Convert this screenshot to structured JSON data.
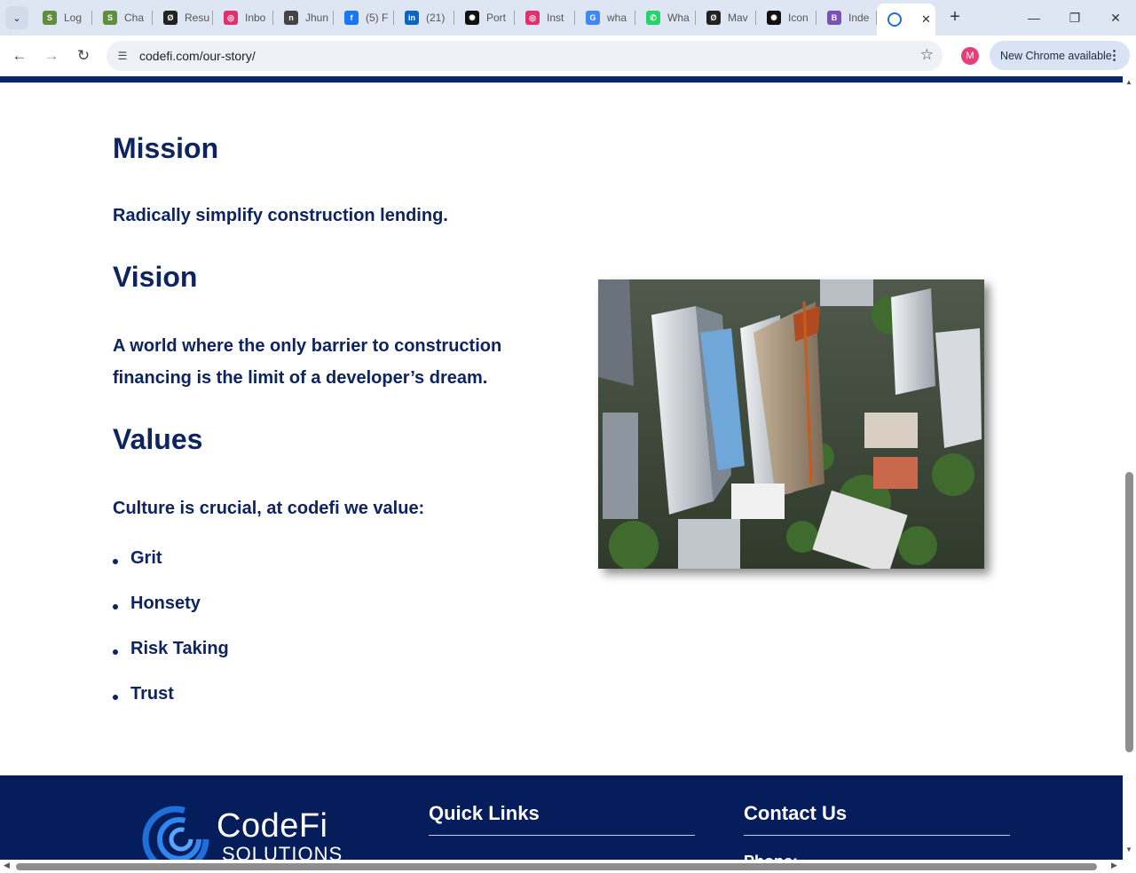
{
  "browser": {
    "tabs": [
      {
        "title": "Log",
        "icon": "shopify-icon",
        "color": "#5e8e3e",
        "glyph": "S"
      },
      {
        "title": "Cha",
        "icon": "shopify-icon",
        "color": "#5e8e3e",
        "glyph": "S"
      },
      {
        "title": "Resu",
        "icon": "slash-circle-icon",
        "color": "#222222",
        "glyph": "Ø"
      },
      {
        "title": "Inbo",
        "icon": "instagram-icon",
        "color": "#e1306c",
        "glyph": "◎"
      },
      {
        "title": "Jhun",
        "icon": "news-icon",
        "color": "#444444",
        "glyph": "n"
      },
      {
        "title": "(5) F",
        "icon": "facebook-icon",
        "color": "#1877f2",
        "glyph": "f"
      },
      {
        "title": "(21)",
        "icon": "linkedin-icon",
        "color": "#0a66c2",
        "glyph": "in"
      },
      {
        "title": "Port",
        "icon": "openai-icon",
        "color": "#111111",
        "glyph": "✺"
      },
      {
        "title": "Inst",
        "icon": "instagram-icon",
        "color": "#e1306c",
        "glyph": "◎"
      },
      {
        "title": "wha",
        "icon": "google-icon",
        "color": "#4285f4",
        "glyph": "G"
      },
      {
        "title": "Wha",
        "icon": "whatsapp-icon",
        "color": "#25d366",
        "glyph": "✆"
      },
      {
        "title": "Mav",
        "icon": "slash-circle-icon",
        "color": "#222222",
        "glyph": "Ø"
      },
      {
        "title": "Icon",
        "icon": "openai-icon",
        "color": "#111111",
        "glyph": "✺"
      },
      {
        "title": "Inde",
        "icon": "bootstrap-icon",
        "color": "#7952b3",
        "glyph": "B"
      }
    ],
    "active_tab_icon": "codefi-icon",
    "url": "codefi.com/our-story/",
    "profile_initial": "M",
    "update_label": "New Chrome available"
  },
  "page": {
    "mission": {
      "heading": "Mission",
      "text": "Radically simplify construction lending."
    },
    "vision": {
      "heading": "Vision",
      "text": "A world where the only barrier to construction financing is the limit of a developer’s dream."
    },
    "values": {
      "heading": "Values",
      "intro": "Culture is crucial, at codefi we value:",
      "items": [
        "Grit",
        "Honsety",
        "Risk Taking",
        "Trust"
      ]
    },
    "image": {
      "description_icon": "city-aerial-photo"
    }
  },
  "footer": {
    "logo_name": "CodeFi",
    "logo_sub": "SOLUTIONS",
    "quick_links_title": "Quick Links",
    "quick_links_peek": "",
    "contact_title": "Contact Us",
    "contact_peek": "Phone:"
  },
  "colors": {
    "navy": "#0d2461",
    "footer_bg": "#061d5c",
    "accent_blue": "#1e6fd9"
  }
}
